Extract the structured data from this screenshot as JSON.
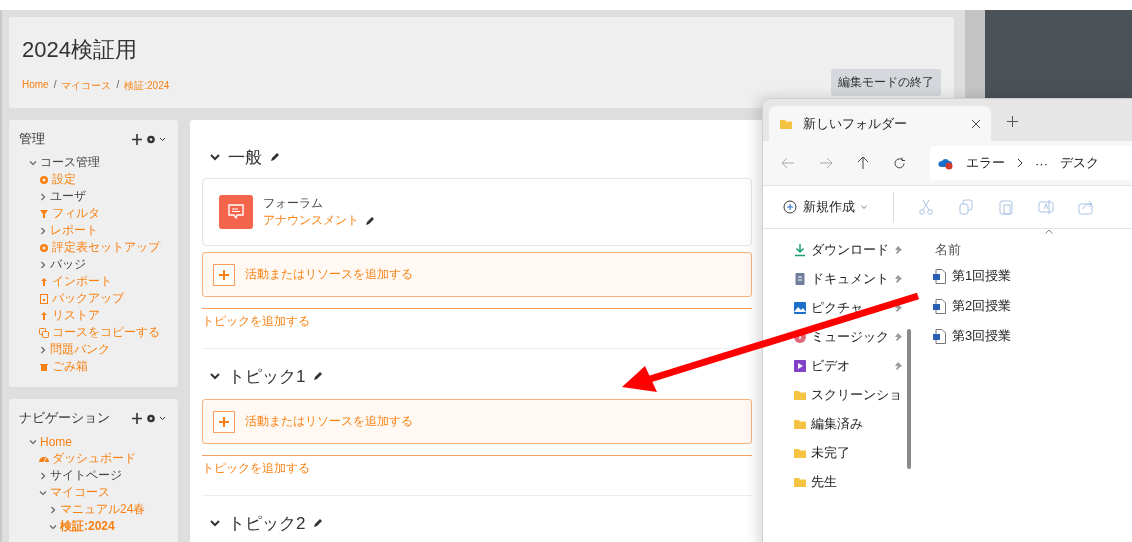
{
  "course": {
    "title": "2024検証用",
    "breadcrumb": [
      "Home",
      "マイコース",
      "検証:2024"
    ],
    "breadcrumb_separator": "/",
    "edit_button": "編集モードの終了"
  },
  "admin_block": {
    "title": "管理",
    "items": [
      {
        "label": "コース管理",
        "kind": "branch",
        "link": false,
        "expanded": true,
        "children": [
          {
            "label": "設定",
            "kind": "settings"
          },
          {
            "label": "ユーザ",
            "kind": "branch",
            "link": false,
            "expanded": false
          },
          {
            "label": "フィルタ",
            "kind": "filter"
          },
          {
            "label": "レポート",
            "kind": "branch",
            "link": true,
            "expanded": false
          },
          {
            "label": "評定表セットアップ",
            "kind": "settings"
          },
          {
            "label": "バッジ",
            "kind": "branch",
            "link": false,
            "expanded": false
          },
          {
            "label": "インポート",
            "kind": "upload"
          },
          {
            "label": "バックアップ",
            "kind": "backup"
          },
          {
            "label": "リストア",
            "kind": "upload"
          },
          {
            "label": "コースをコピーする",
            "kind": "copy"
          },
          {
            "label": "問題バンク",
            "kind": "branch",
            "link": true,
            "expanded": false
          },
          {
            "label": "ごみ箱",
            "kind": "trash"
          }
        ]
      }
    ]
  },
  "navigation_block": {
    "title": "ナビゲーション",
    "items": [
      {
        "label": "Home",
        "kind": "branch",
        "link": true,
        "expanded": true,
        "children": [
          {
            "label": "ダッシュボード",
            "kind": "dashboard"
          },
          {
            "label": "サイトページ",
            "kind": "branch",
            "link": false,
            "expanded": false
          },
          {
            "label": "マイコース",
            "kind": "branch",
            "link": true,
            "expanded": true,
            "children": [
              {
                "label": "マニュアル24春",
                "kind": "branch",
                "link": true,
                "expanded": false
              },
              {
                "label": "検証:2024",
                "kind": "branch",
                "link": true,
                "expanded": true,
                "current": true
              }
            ]
          }
        ]
      }
    ]
  },
  "sections": [
    {
      "title": "一般",
      "activities": [
        {
          "type": "フォーラム",
          "name": "アナウンスメント"
        }
      ],
      "add_activity": "活動またはリソースを追加する",
      "add_topic": "トピックを追加する"
    },
    {
      "title": "トピック1",
      "add_activity": "活動またはリソースを追加する",
      "add_topic": "トピックを追加する"
    },
    {
      "title": "トピック2"
    }
  ],
  "explorer": {
    "tab_title": "新しいフォルダー",
    "path": [
      "エラー",
      "···",
      "デスク"
    ],
    "new_button": "新規作成",
    "nav_items": [
      {
        "label": "ダウンロード",
        "kind": "download",
        "pinned": true
      },
      {
        "label": "ドキュメント",
        "kind": "document",
        "pinned": true
      },
      {
        "label": "ピクチャ",
        "kind": "picture",
        "pinned": true
      },
      {
        "label": "ミュージック",
        "kind": "music",
        "pinned": true
      },
      {
        "label": "ビデオ",
        "kind": "video",
        "pinned": true
      },
      {
        "label": "スクリーンショ",
        "kind": "folder",
        "pinned": false
      },
      {
        "label": "編集済み",
        "kind": "folder",
        "pinned": false
      },
      {
        "label": "未完了",
        "kind": "folder",
        "pinned": false
      },
      {
        "label": "先生",
        "kind": "folder",
        "pinned": false
      }
    ],
    "column_header": "名前",
    "files": [
      {
        "name": "第1回授業"
      },
      {
        "name": "第2回授業"
      },
      {
        "name": "第3回授業"
      }
    ]
  }
}
